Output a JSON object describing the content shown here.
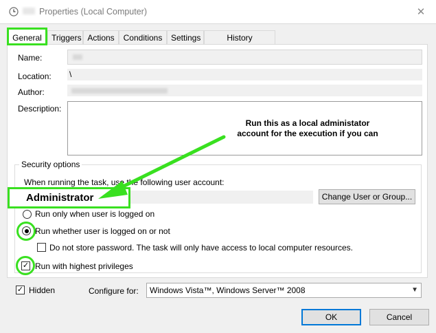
{
  "window": {
    "title": "Properties (Local Computer)",
    "close_glyph": "✕",
    "icon": "clock-icon"
  },
  "tabs": [
    {
      "label": "General",
      "active": true
    },
    {
      "label": "Triggers"
    },
    {
      "label": "Actions"
    },
    {
      "label": "Conditions"
    },
    {
      "label": "Settings"
    },
    {
      "label": "History (disabled)"
    }
  ],
  "general": {
    "name_label": "Name:",
    "location_label": "Location:",
    "location_value": "\\",
    "author_label": "Author:",
    "description_label": "Description:"
  },
  "security": {
    "group_title": "Security options",
    "prompt": "When running the task, use the following user account:",
    "user_account": "Administrator",
    "change_button": "Change User or Group...",
    "radio_logged_on": "Run only when user is logged on",
    "radio_whether": "Run whether user is logged on or not",
    "radio_selected": "whether",
    "no_store_password": "Do not store password.  The task will only have access to local computer resources.",
    "no_store_checked": false,
    "highest_privileges": "Run with highest privileges",
    "highest_checked": true
  },
  "bottom": {
    "hidden_label": "Hidden",
    "hidden_checked": true,
    "configure_label": "Configure for:",
    "configure_value": "Windows Vista™, Windows Server™ 2008",
    "ok_label": "OK",
    "cancel_label": "Cancel"
  },
  "annotation": {
    "line1": "Run this as a local administator",
    "line2": "account for the execution if you can",
    "color": "#39e020"
  },
  "colors": {
    "highlight": "#39e020",
    "focus_border": "#0078d7"
  }
}
